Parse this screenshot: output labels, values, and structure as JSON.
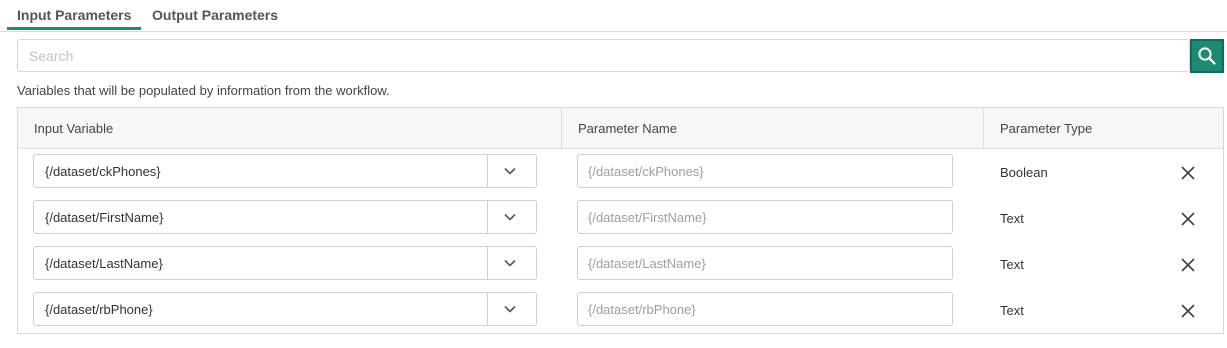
{
  "tabs": [
    {
      "label": "Input Parameters",
      "active": true
    },
    {
      "label": "Output Parameters",
      "active": false
    }
  ],
  "search": {
    "placeholder": "Search",
    "value": ""
  },
  "description": "Variables that will be populated by information from the workflow.",
  "table": {
    "headers": [
      "Input Variable",
      "Parameter Name",
      "Parameter Type"
    ],
    "rows": [
      {
        "input_variable": "{/dataset/ckPhones}",
        "parameter_name_placeholder": "{/dataset/ckPhones}",
        "parameter_type": "Boolean",
        "highlighted": true
      },
      {
        "input_variable": "{/dataset/FirstName}",
        "parameter_name_placeholder": "{/dataset/FirstName}",
        "parameter_type": "Text",
        "highlighted": false
      },
      {
        "input_variable": "{/dataset/LastName}",
        "parameter_name_placeholder": "{/dataset/LastName}",
        "parameter_type": "Text",
        "highlighted": false
      },
      {
        "input_variable": "{/dataset/rbPhone}",
        "parameter_name_placeholder": "{/dataset/rbPhone}",
        "parameter_type": "Text",
        "highlighted": false
      }
    ]
  },
  "icons": {
    "search": "search-icon",
    "dropdown": "chevron-down-icon",
    "delete": "close-icon"
  },
  "colors": {
    "accent": "#1d8a74",
    "highlight": "#ffff00"
  }
}
